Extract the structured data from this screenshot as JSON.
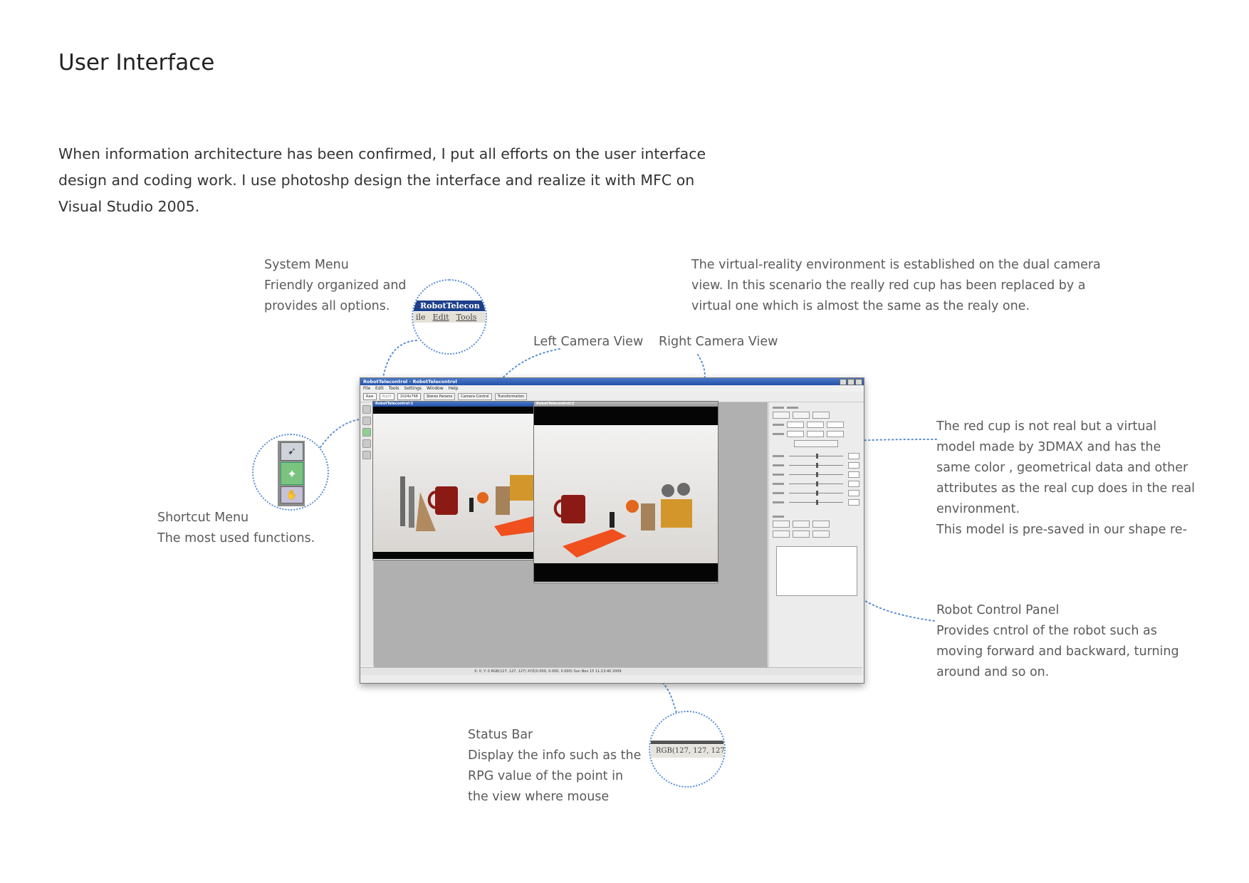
{
  "page": {
    "title": "User Interface",
    "intro_lines": [
      "When information architecture has been confirmed, I put all efforts on the user interface",
      "design and coding work. I use photoshp design the interface and realize it with MFC on",
      "Visual Studio 2005."
    ]
  },
  "annotations": {
    "system_menu": {
      "lines": [
        "System Menu",
        "Friendly organized and",
        "provides all options."
      ]
    },
    "virtual_reality": {
      "lines": [
        "The virtual-reality environment is established on the dual camera",
        "view. In this scenario the really red cup has been replaced by a",
        "virtual one which is almost the same as the realy one."
      ]
    },
    "left_camera": "Left Camera View",
    "right_camera": "Right Camera View",
    "shortcut_menu": {
      "lines": [
        "Shortcut Menu",
        "The most used functions."
      ]
    },
    "red_cup": {
      "lines": [
        "The red cup is not real but a virtual",
        "model made by 3DMAX and has the",
        "same color , geometrical data and other",
        "attributes as the real cup does in the real",
        "environment.",
        "This model is pre-saved in our shape re-"
      ]
    },
    "robot_control": {
      "lines": [
        "Robot Control Panel",
        "Provides cntrol of the robot such as",
        "moving forward and backward, turning",
        "around and so on."
      ]
    },
    "status_bar": {
      "lines": [
        "Status Bar",
        "Display the info such as the",
        "RPG value of the point in",
        "the view where mouse"
      ]
    }
  },
  "app": {
    "title": "RobotTelecontrol - RobotTelecontrol",
    "menu": [
      "File",
      "Edit",
      "Tools",
      "Settings",
      "Window",
      "Help"
    ],
    "toolbar": {
      "selects": [
        "Raw",
        "Right",
        "1024x768"
      ],
      "buttons": [
        "Stereo Params",
        "Camera Control",
        "Transformation"
      ]
    },
    "left_child_title": "RobotTelecontrol:1",
    "right_child_title": "RobotTelecontrol:2",
    "status_text": "X: 0, Y: 0    RGB(127, 127, 127)    XYZ(0.000, 0.000, 0.000)    Sun Nov 15 11:13:40 2009",
    "zoom_menu_title": "RobotTelecon",
    "zoom_menu_items": [
      "ile",
      "Edit",
      "Tools"
    ],
    "zoom_status_text": "RGB(127, 127, 127"
  },
  "colors": {
    "annotation_line": "#5b8fd6",
    "titlebar": "#2351a8",
    "cup_red": "#8b1a14",
    "cutter_orange": "#f04f1e"
  },
  "icons": [
    "shortcut-select-icon",
    "shortcut-robot-icon",
    "shortcut-grab-icon"
  ]
}
